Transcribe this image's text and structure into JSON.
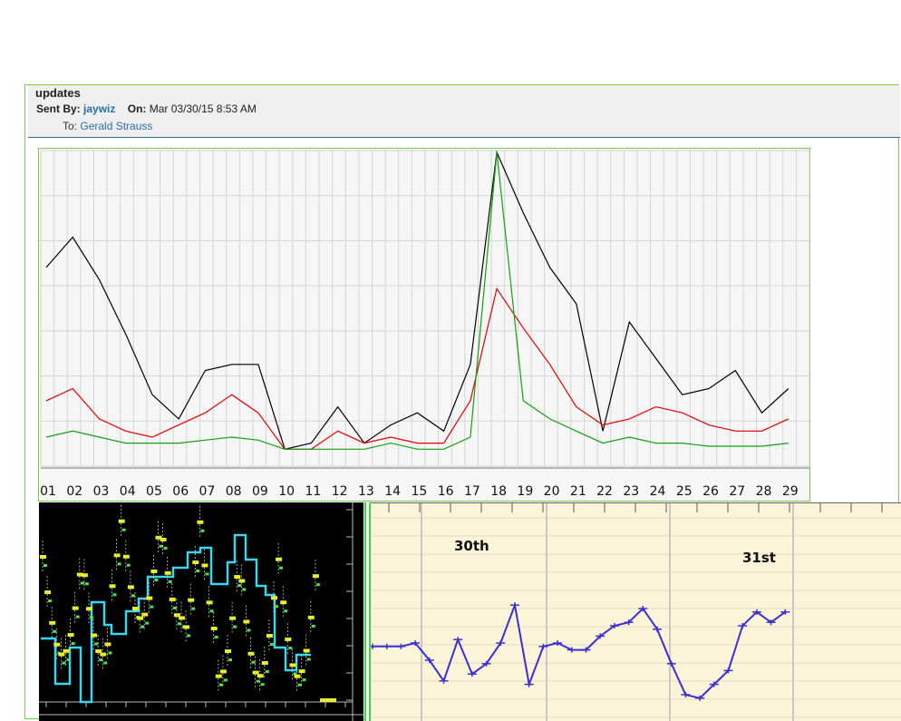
{
  "message": {
    "subject": "updates",
    "sent_by_label": "Sent By:",
    "sender": "jaywiz",
    "on_label": "On:",
    "date": "Mar 03/30/15 8:53 AM",
    "to_label": "To:",
    "recipient": "Gerald Strauss"
  },
  "chart_data": [
    {
      "type": "line",
      "categories": [
        "01",
        "02",
        "03",
        "04",
        "05",
        "06",
        "07",
        "08",
        "09",
        "10",
        "11",
        "12",
        "13",
        "14",
        "15",
        "16",
        "17",
        "18",
        "19",
        "20",
        "21",
        "22",
        "23",
        "24",
        "25",
        "26",
        "27",
        "28",
        "29"
      ],
      "grid": true,
      "series": [
        {
          "color": "#000000",
          "values": [
            62,
            72,
            58,
            40,
            20,
            12,
            28,
            30,
            30,
            2,
            4,
            16,
            4,
            10,
            14,
            8,
            30,
            100,
            80,
            62,
            50,
            8,
            44,
            32,
            20,
            22,
            28,
            14,
            22
          ]
        },
        {
          "color": "#e00000",
          "values": [
            18,
            22,
            12,
            8,
            6,
            10,
            14,
            20,
            14,
            2,
            2,
            8,
            4,
            6,
            4,
            4,
            18,
            55,
            42,
            30,
            16,
            10,
            12,
            16,
            14,
            10,
            8,
            8,
            12
          ]
        },
        {
          "color": "#12a012",
          "values": [
            6,
            8,
            6,
            4,
            4,
            4,
            5,
            6,
            5,
            2,
            2,
            2,
            2,
            4,
            2,
            2,
            6,
            100,
            18,
            12,
            8,
            4,
            6,
            4,
            4,
            3,
            3,
            3,
            4
          ]
        }
      ]
    },
    {
      "type": "line",
      "annotations": [
        "30th",
        "31st"
      ],
      "series": [
        {
          "color": "#3a2fd0",
          "values": [
            38,
            38,
            38,
            40,
            30,
            18,
            42,
            22,
            28,
            40,
            62,
            16,
            38,
            40,
            36,
            36,
            44,
            50,
            52,
            60,
            48,
            28,
            10,
            8,
            16,
            24,
            50,
            58,
            52,
            58
          ]
        }
      ]
    }
  ]
}
